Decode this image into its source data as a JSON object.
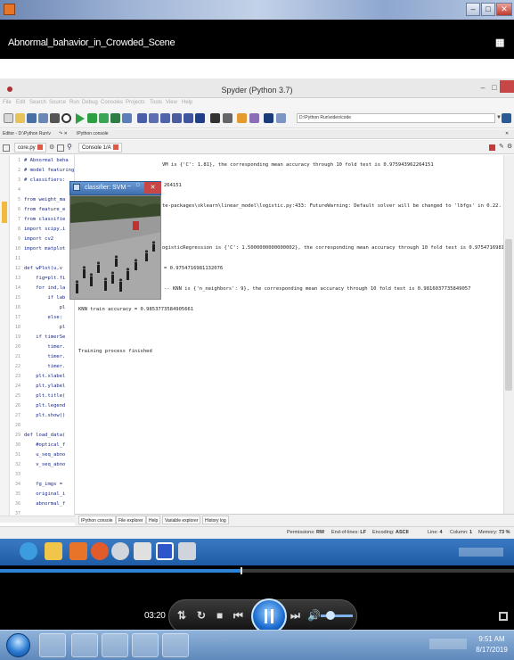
{
  "media_player": {
    "video_title": "Abnormal_bahavior_in_Crowded_Scene",
    "window_controls": {
      "minimize": "–",
      "maximize": "□",
      "close": "✕"
    },
    "time": "03:20",
    "progress": 0.47,
    "volume": 0.3
  },
  "spyder": {
    "title": "Spyder (Python 3.7)",
    "menu": [
      "File",
      "Edit",
      "Search",
      "Source",
      "Run",
      "Debug",
      "Consoles",
      "Projects",
      "Tools",
      "View",
      "Help"
    ],
    "path": "D:\\Python Run\\video\\code",
    "editor_pane_label": "Editor - D:\\Python Run\\v",
    "console_pane_label": "IPython console",
    "editor_tab": "core.py",
    "console_tab": "Console 1/A",
    "editor_lines": [
      {
        "n": "1",
        "t": "# Abnormal beha"
      },
      {
        "n": "2",
        "t": "# model featuring"
      },
      {
        "n": "3",
        "t": "# classifiers:"
      },
      {
        "n": "4",
        "t": ""
      },
      {
        "n": "5",
        "t": "from weight_ma"
      },
      {
        "n": "6",
        "t": "from feature_e"
      },
      {
        "n": "7",
        "t": "from classifie"
      },
      {
        "n": "8",
        "t": "import scipy.i"
      },
      {
        "n": "9",
        "t": "import cv2"
      },
      {
        "n": "10",
        "t": "import matplot"
      },
      {
        "n": "11",
        "t": ""
      },
      {
        "n": "12",
        "t": "def wPlot(u,v"
      },
      {
        "n": "13",
        "t": "    fig=plt.fi"
      },
      {
        "n": "14",
        "t": "    for ind,la"
      },
      {
        "n": "15",
        "t": "        if lab"
      },
      {
        "n": "16",
        "t": "            pl"
      },
      {
        "n": "17",
        "t": "        else:"
      },
      {
        "n": "18",
        "t": "            pl"
      },
      {
        "n": "19",
        "t": "    if timerSe"
      },
      {
        "n": "20",
        "t": "        timer."
      },
      {
        "n": "21",
        "t": "        timer."
      },
      {
        "n": "22",
        "t": "        timer."
      },
      {
        "n": "23",
        "t": "    plt.xlabel"
      },
      {
        "n": "24",
        "t": "    plt.ylabel"
      },
      {
        "n": "25",
        "t": "    plt.title("
      },
      {
        "n": "26",
        "t": "    plt.legend"
      },
      {
        "n": "27",
        "t": "    plt.show()"
      },
      {
        "n": "28",
        "t": ""
      },
      {
        "n": "29",
        "t": "def load_data("
      },
      {
        "n": "30",
        "t": "    #optical_f"
      },
      {
        "n": "31",
        "t": "    u_seq_abno"
      },
      {
        "n": "32",
        "t": "    v_seq_abno"
      },
      {
        "n": "33",
        "t": ""
      },
      {
        "n": "34",
        "t": "    fg_imgs ="
      },
      {
        "n": "35",
        "t": "    original_i"
      },
      {
        "n": "36",
        "t": "    abnormal_f"
      },
      {
        "n": "37",
        "t": ""
      }
    ],
    "console_lines": [
      "VM is {'C': 1.81}, the corresponding mean accuracy through 10 fold test is 0.975943962264151",
      "",
      "264151",
      "",
      "te-packages\\sklearn\\linear_model\\logistic.py:433: FutureWarning: Default solver will be changed to 'lbfgs' in 0.22. Specify a solver",
      "",
      "",
      "",
      "ogisticRegression is {'C': 1.5000000000000002}, the corresponding mean accuracy through 10 fold test is 0.9754716981132076",
      "",
      "= 0.9754716981132076",
      "",
      "The best hyper-parameter for -- KNN is {'n_neighbors': 9}, the corresponding mean accuracy through 10 fold test is 0.9816037735849057",
      "",
      "KNN train accuracy = 0.9853773584905661",
      "",
      "",
      "",
      "Training process finished"
    ],
    "popup_title": "classifier: SVM",
    "bottom_tabs": [
      "IPython console",
      "File explorer",
      "Help",
      "Variable explorer",
      "History log"
    ],
    "status": {
      "permissions_label": "Permissions:",
      "permissions_value": "RW",
      "eol_label": "End-of-lines:",
      "eol_value": "LF",
      "encoding_label": "Encoding:",
      "encoding_value": "ASCII",
      "line_label": "Line:",
      "line_value": "4",
      "column_label": "Column:",
      "column_value": "1",
      "memory_label": "Memory:",
      "memory_value": "73 %"
    }
  },
  "os": {
    "clock_time": "9:51 AM",
    "clock_date": "8/17/2019"
  },
  "colors": {
    "accent_blue": "#2f83d6",
    "close_red": "#c74646",
    "taskbar_blue": "#5f89bc"
  }
}
